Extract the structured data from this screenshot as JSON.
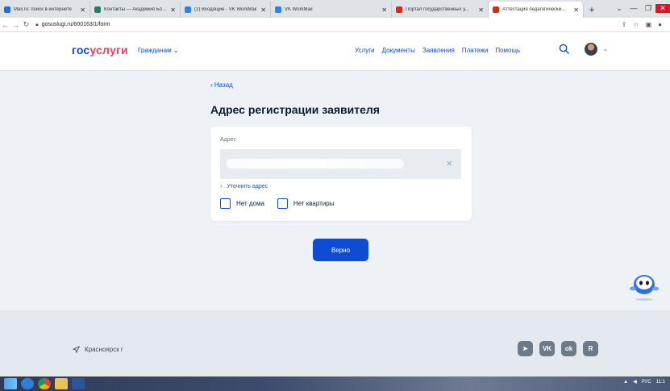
{
  "browser": {
    "tabs": [
      {
        "label": "Mail.ru: поиск в интернете",
        "fav_color": "#1e6fd9"
      },
      {
        "label": "Контакты — Академия Бор...",
        "fav_color": "#2a7d6b"
      },
      {
        "label": "(2) Входящие - VK WorkMail",
        "fav_color": "#2b82f0"
      },
      {
        "label": "VK WorkMail",
        "fav_color": "#2b82f0"
      },
      {
        "label": "Портал государственных у...",
        "fav_color": "#d52b1e"
      },
      {
        "label": "Аттестация педагогически...",
        "fav_color": "#d52b1e"
      }
    ],
    "active_tab": 5,
    "new_tab": "+",
    "url": "gosuslugi.ru/600163/1/form"
  },
  "header": {
    "logo_part1": "гос",
    "logo_part2": "услуги",
    "citizens": "Гражданам ⌄",
    "nav": [
      "Услуги",
      "Документы",
      "Заявления",
      "Платежи",
      "Помощь"
    ],
    "avatar_chevron": "⌄"
  },
  "main": {
    "back": "‹ Назад",
    "title": "Адрес регистрации заявителя",
    "address_label": "Адрес",
    "clear_icon": "×",
    "refine": "Уточнить адрес",
    "refine_chevron": "›",
    "no_house": "Нет дома",
    "no_flat": "Нет квартиры",
    "submit": "Верно"
  },
  "footer": {
    "city": "Красноярск г",
    "social": [
      "telegram-icon",
      "vk-icon",
      "ok-icon",
      "rutube-icon"
    ]
  },
  "taskbar": {
    "lang": "РУС",
    "time": "11:1"
  },
  "colors": {
    "brand_blue": "#0d4cd3",
    "brand_red": "#ee3f58",
    "page_bg": "#eef2f7"
  }
}
